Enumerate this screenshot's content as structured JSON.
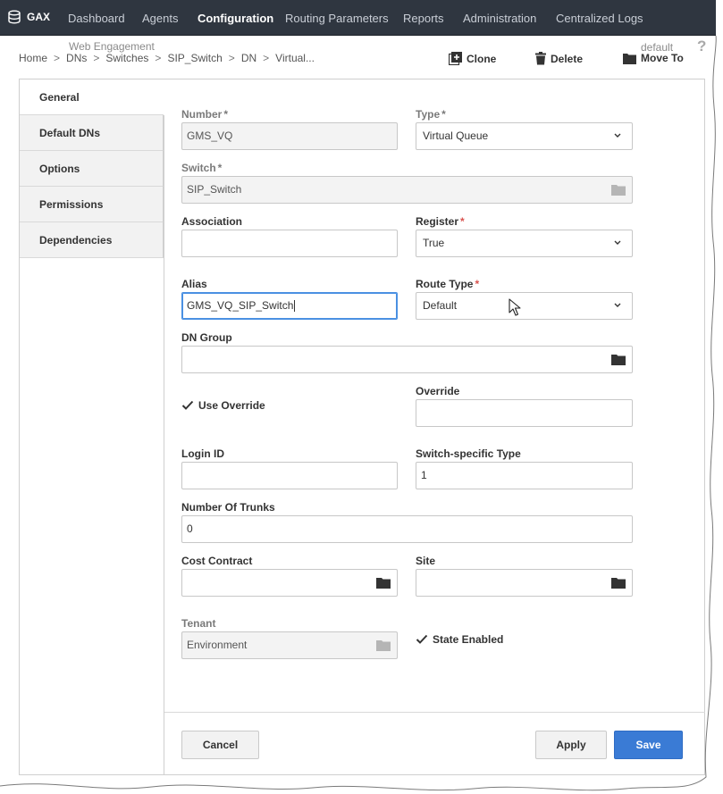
{
  "nav": {
    "brand": "GAX",
    "items": [
      "Dashboard",
      "Agents",
      "Configuration",
      "Routing Parameters",
      "Reports",
      "Administration",
      "Centralized Logs"
    ],
    "active": "Configuration"
  },
  "header": {
    "context_tag": "Web Engagement",
    "breadcrumb": [
      "Home",
      "DNs",
      "Switches",
      "SIP_Switch",
      "DN",
      "Virtual..."
    ],
    "separator": ">",
    "tenant_tag": "default",
    "help": "?",
    "actions": {
      "clone": "Clone",
      "delete": "Delete",
      "move_to": "Move To"
    }
  },
  "sidebar": {
    "items": [
      "General",
      "Default DNs",
      "Options",
      "Permissions",
      "Dependencies"
    ],
    "active": "General"
  },
  "form": {
    "required_mark": "*",
    "number": {
      "label": "Number",
      "value": "GMS_VQ"
    },
    "type": {
      "label": "Type",
      "value": "Virtual Queue"
    },
    "switch": {
      "label": "Switch",
      "value": "SIP_Switch"
    },
    "association": {
      "label": "Association",
      "value": ""
    },
    "register": {
      "label": "Register",
      "value": "True"
    },
    "alias": {
      "label": "Alias",
      "value": "GMS_VQ_SIP_Switch"
    },
    "route_type": {
      "label": "Route Type",
      "value": "Default"
    },
    "dn_group": {
      "label": "DN Group",
      "value": ""
    },
    "use_override": {
      "label": "Use Override",
      "checked": true
    },
    "override": {
      "label": "Override",
      "value": ""
    },
    "login_id": {
      "label": "Login ID",
      "value": ""
    },
    "switch_specific_type": {
      "label": "Switch-specific Type",
      "value": "1"
    },
    "number_of_trunks": {
      "label": "Number Of Trunks",
      "value": "0"
    },
    "cost_contract": {
      "label": "Cost Contract",
      "value": ""
    },
    "site": {
      "label": "Site",
      "value": ""
    },
    "tenant": {
      "label": "Tenant",
      "value": "Environment"
    },
    "state_enabled": {
      "label": "State Enabled",
      "checked": true
    }
  },
  "buttons": {
    "cancel": "Cancel",
    "apply": "Apply",
    "save": "Save"
  },
  "colors": {
    "nav_bg": "#2f3640",
    "primary": "#3a7bd5",
    "required": "#d9534f",
    "focus": "#4a90e2"
  }
}
